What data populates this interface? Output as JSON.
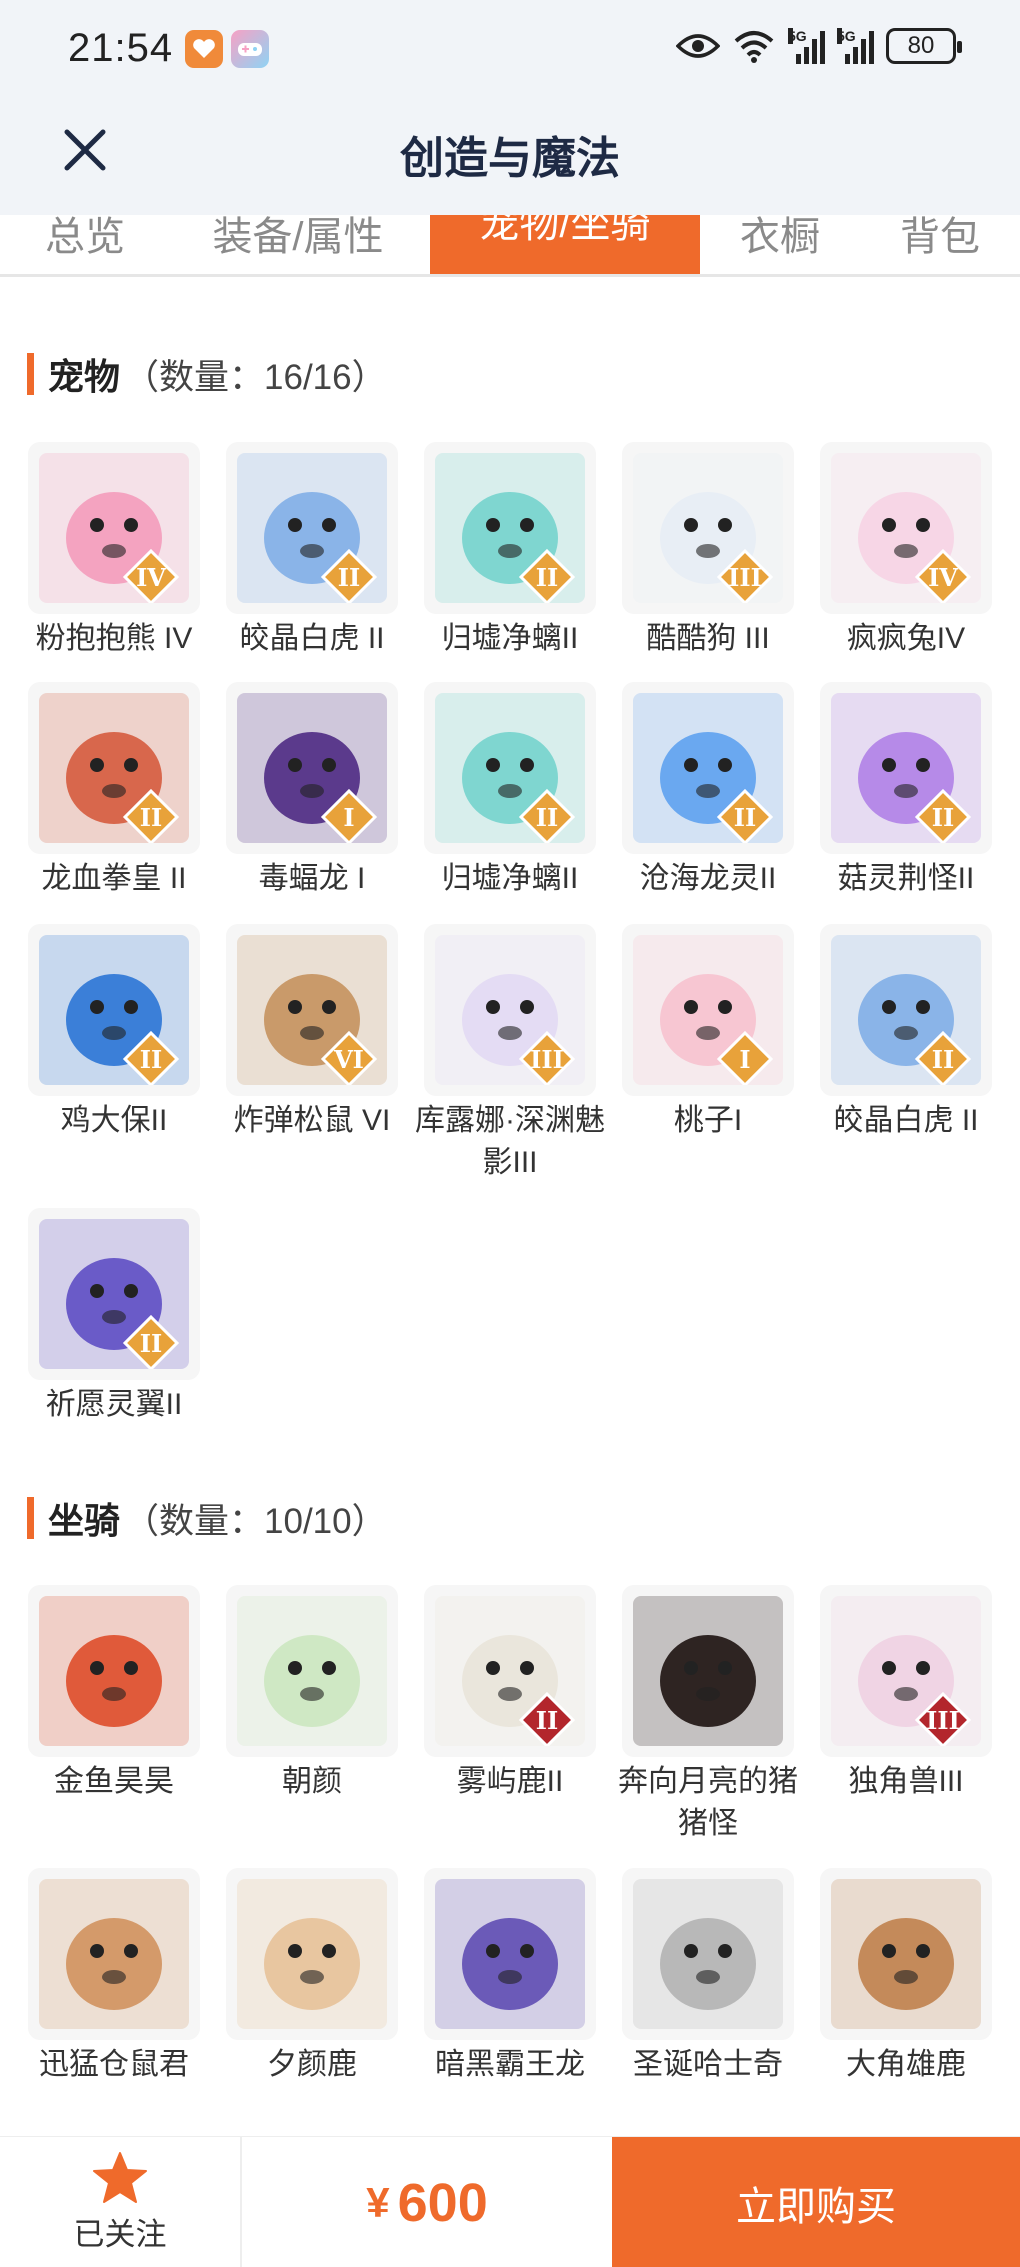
{
  "status_bar": {
    "time": "21:54",
    "network_1": "5G",
    "network_2": "5G",
    "battery": "80"
  },
  "header": {
    "title": "创造与魔法"
  },
  "tabs": [
    {
      "label": "总览"
    },
    {
      "label": "装备/属性"
    },
    {
      "label": "宠物/坐骑"
    },
    {
      "label": "衣橱"
    },
    {
      "label": "背包"
    }
  ],
  "pets": {
    "title": "宠物",
    "count": "（数量：16/16）",
    "items": [
      {
        "name": "粉抱抱熊 IV",
        "badge": "IV"
      },
      {
        "name": "皎晶白虎 II",
        "badge": "II"
      },
      {
        "name": "归墟净螭II",
        "badge": "II"
      },
      {
        "name": "酷酷狗 III",
        "badge": "III"
      },
      {
        "name": "疯疯兔IV",
        "badge": "IV"
      },
      {
        "name": "龙血拳皇 II",
        "badge": "II"
      },
      {
        "name": "毒蝠龙 I",
        "badge": "I"
      },
      {
        "name": "归墟净螭II",
        "badge": "II"
      },
      {
        "name": "沧海龙灵II",
        "badge": "II"
      },
      {
        "name": "菇灵荆怪II",
        "badge": "II"
      },
      {
        "name": "鸡大保II",
        "badge": "II"
      },
      {
        "name": "炸弹松鼠 VI",
        "badge": "VI"
      },
      {
        "name": "库露娜·深渊魅影III",
        "badge": "III"
      },
      {
        "name": "桃子I",
        "badge": "I"
      },
      {
        "name": "皎晶白虎 II",
        "badge": "II"
      },
      {
        "name": "祈愿灵翼II",
        "badge": "II"
      }
    ]
  },
  "mounts": {
    "title": "坐骑",
    "count": "（数量：10/10）",
    "items": [
      {
        "name": "金鱼昊昊",
        "badge": ""
      },
      {
        "name": "朝颜",
        "badge": ""
      },
      {
        "name": "雾屿鹿II",
        "badge": "II"
      },
      {
        "name": "奔向月亮的猪猪怪",
        "badge": ""
      },
      {
        "name": "独角兽III",
        "badge": "III"
      },
      {
        "name": "迅猛仓鼠君",
        "badge": ""
      },
      {
        "name": "夕颜鹿",
        "badge": ""
      },
      {
        "name": "暗黑霸王龙",
        "badge": ""
      },
      {
        "name": "圣诞哈士奇",
        "badge": ""
      },
      {
        "name": "大角雄鹿",
        "badge": ""
      }
    ]
  },
  "bottom_bar": {
    "follow_label": "已关注",
    "price_symbol": "¥",
    "price": "600",
    "buy_label": "立即购买"
  },
  "colors": {
    "accent": "#ef6a2b",
    "badge_gold": "#e8a23a",
    "badge_red": "#b3262c"
  }
}
